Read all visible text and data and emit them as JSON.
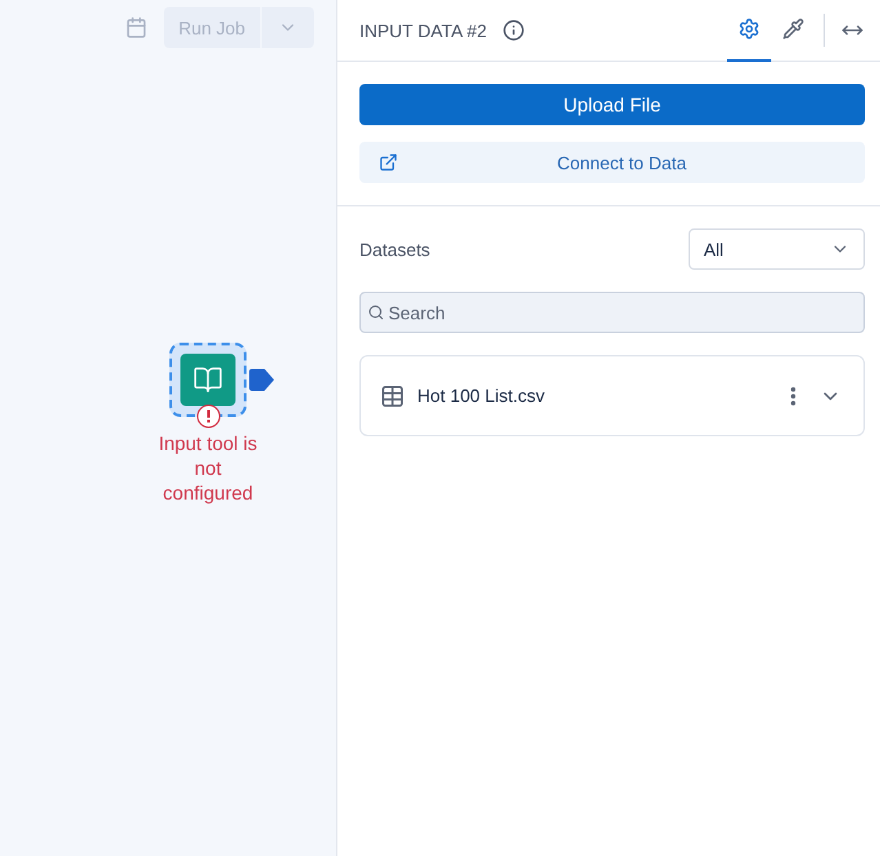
{
  "toolbar": {
    "run_button": {
      "label": "Run Job",
      "disabled": true
    }
  },
  "canvas": {
    "node": {
      "error": true,
      "message": "Input tool is not configured"
    }
  },
  "panel": {
    "title": "INPUT DATA #2",
    "tabs": [
      {
        "kind": "gear",
        "selected": true
      },
      {
        "kind": "pipette",
        "selected": false
      }
    ],
    "upload_button": "Upload File",
    "connect_button": "Connect to Data",
    "datasets_label": "Datasets",
    "filter": {
      "value": "All"
    },
    "search": {
      "placeholder": "Search"
    },
    "datasets": [
      {
        "name": "Hot 100 List.csv",
        "expanded": false
      }
    ]
  }
}
